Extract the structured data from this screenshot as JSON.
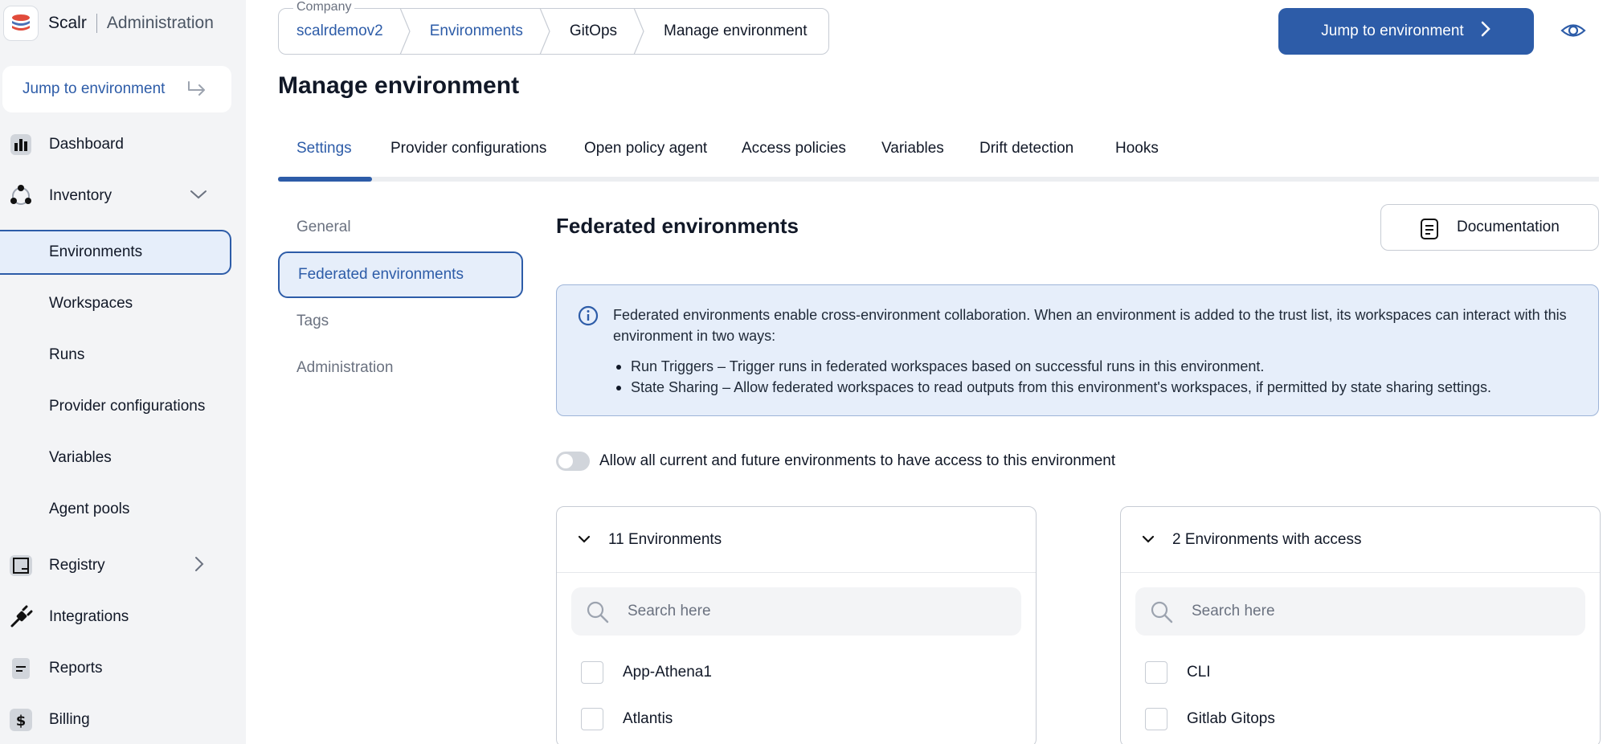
{
  "app": {
    "name": "Scalr",
    "section": "Administration"
  },
  "sidebar": {
    "jump_label": "Jump to environment",
    "items": [
      {
        "label": "Dashboard",
        "icon": "dashboard-icon"
      },
      {
        "label": "Inventory",
        "icon": "inventory-icon",
        "expanded": true
      },
      {
        "label": "Environments",
        "active": true
      },
      {
        "label": "Workspaces"
      },
      {
        "label": "Runs"
      },
      {
        "label": "Provider configurations"
      },
      {
        "label": "Variables"
      },
      {
        "label": "Agent pools"
      },
      {
        "label": "Registry",
        "icon": "registry-icon"
      },
      {
        "label": "Integrations",
        "icon": "integrations-icon"
      },
      {
        "label": "Reports",
        "icon": "reports-icon"
      },
      {
        "label": "Billing",
        "icon": "billing-icon"
      }
    ]
  },
  "header": {
    "company_label": "Company",
    "breadcrumb": [
      "scalrdemov2",
      "Environments",
      "GitOps",
      "Manage environment"
    ],
    "jump_button": "Jump to environment",
    "page_title": "Manage environment"
  },
  "tabs": [
    "Settings",
    "Provider configurations",
    "Open policy agent",
    "Access policies",
    "Variables",
    "Drift detection",
    "Hooks"
  ],
  "settings_menu": [
    "General",
    "Federated environments",
    "Tags",
    "Administration"
  ],
  "content": {
    "title": "Federated environments",
    "doc_button": "Documentation",
    "info_text": "Federated environments enable cross-environment collaboration. When an environment is added to the trust list, its workspaces can interact with this environment in two ways:",
    "info_bullets": [
      "Run Triggers – Trigger runs in federated workspaces based on successful runs in this environment.",
      "State Sharing – Allow federated workspaces to read outputs from this environment's workspaces, if permitted by state sharing settings."
    ],
    "toggle_label": "Allow all current and future environments to have access to this environment",
    "toggle_on": false,
    "left_panel": {
      "header": "11 Environments",
      "search_placeholder": "Search here",
      "items": [
        "App-Athena1",
        "Atlantis"
      ]
    },
    "right_panel": {
      "header": "2 Environments with access",
      "search_placeholder": "Search here",
      "items": [
        "CLI",
        "Gitlab Gitops"
      ]
    }
  },
  "colors": {
    "accent": "#2d5ca8",
    "accent_light": "#e6eefa",
    "sidebar_bg": "#f3f4f6"
  }
}
